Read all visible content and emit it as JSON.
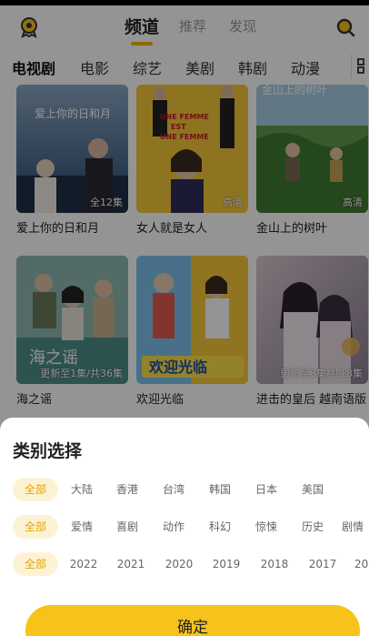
{
  "top_tabs": [
    "频道",
    "推荐",
    "发现"
  ],
  "active_top_tab": "频道",
  "channels": [
    "电视剧",
    "电影",
    "综艺",
    "美剧",
    "韩剧",
    "动漫"
  ],
  "active_channel": "电视剧",
  "cards": [
    {
      "title": "爱上你的日和月",
      "badge": "全12集",
      "poster_text": "爱上你的日和月"
    },
    {
      "title": "女人就是女人",
      "badge": "高清",
      "poster_text": "UNE FEMME EST UNE FEMME"
    },
    {
      "title": "金山上的树叶",
      "badge": "高清",
      "poster_text": "金山上的树叶"
    },
    {
      "title": "海之谣",
      "badge": "更新至1集/共36集",
      "poster_text": "海之谣"
    },
    {
      "title": "欢迎光临",
      "badge": "",
      "poster_text": "欢迎光临"
    },
    {
      "title": "进击的皇后 越南语版",
      "badge": "更新至3集/共18集",
      "poster_text": ""
    }
  ],
  "sheet": {
    "title": "类别选择",
    "confirm_label": "确定",
    "region_row": [
      "全部",
      "大陆",
      "香港",
      "台湾",
      "韩国",
      "日本",
      "美国"
    ],
    "genre_row": [
      "全部",
      "爱情",
      "喜剧",
      "动作",
      "科幻",
      "惊悚",
      "历史",
      "剧情"
    ],
    "year_row": [
      "全部",
      "2022",
      "2021",
      "2020",
      "2019",
      "2018",
      "2017",
      "20"
    ]
  },
  "colors": {
    "accent": "#f7c21a",
    "chip_bg": "#fdf3d4",
    "chip_text": "#e6a400"
  },
  "icons": [
    "medal-icon",
    "search-icon",
    "grid-icon"
  ]
}
